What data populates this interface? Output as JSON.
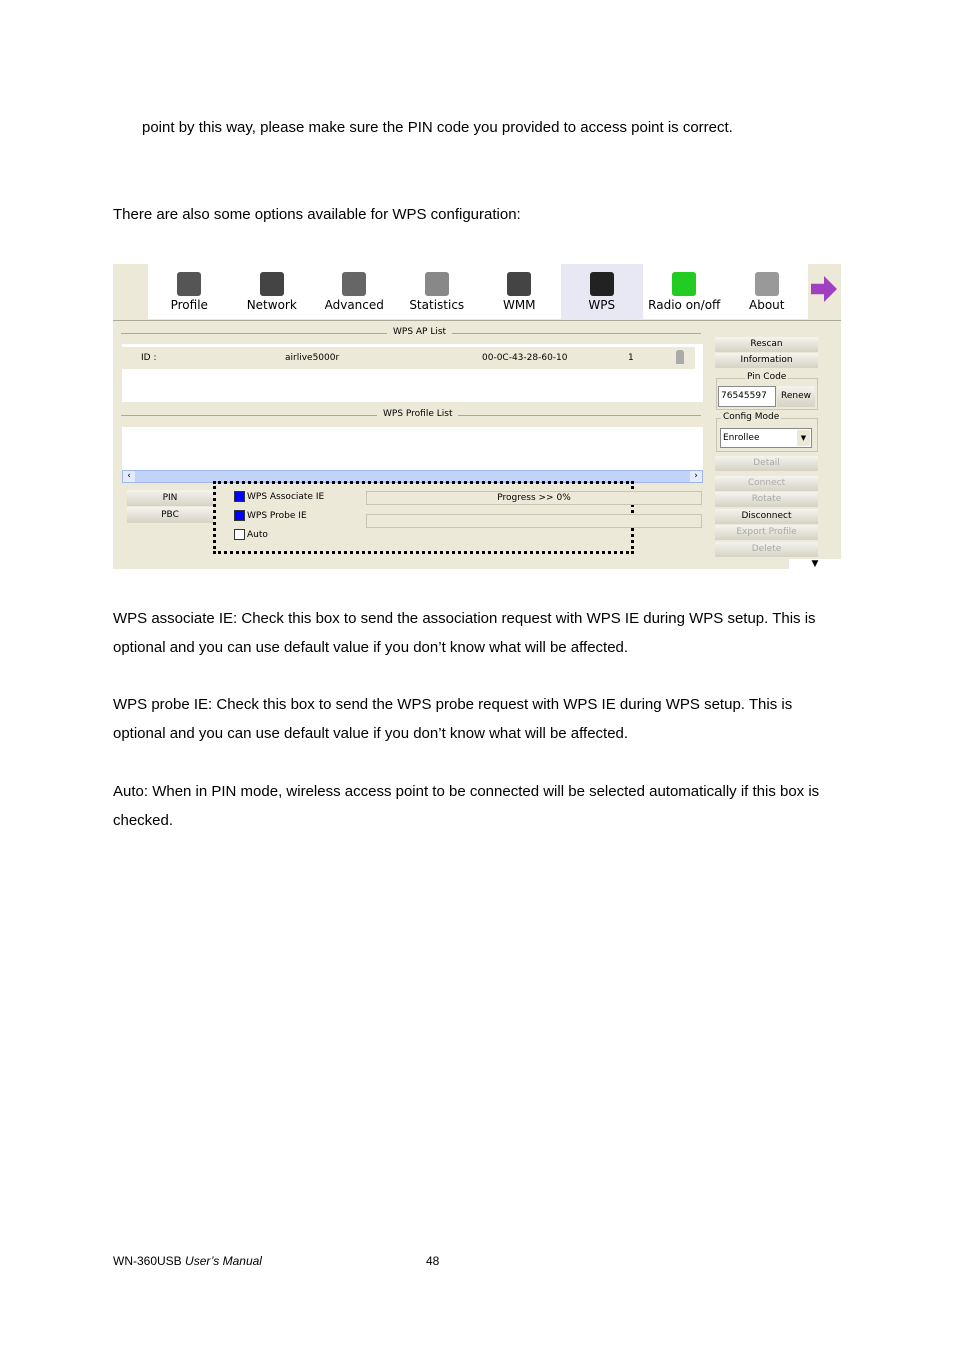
{
  "paragraphs": [
    "point by this way, please make sure the PIN code you provided to access point is correct.",
    "There are also some options available for WPS configuration:",
    "WPS associate IE: Check this box to send the association request with WPS IE during WPS setup. This is optional and you can use default value if you don’t know what will be affected.",
    "WPS probe IE: Check this box to send the WPS probe request with WPS IE during WPS setup. This is optional and you can use default value if you don’t know what will be affected.",
    "Auto: When in PIN mode, wireless access point to be connected will be selected automatically if this box is checked."
  ],
  "toolbar": [
    {
      "label": "Profile",
      "icon": "profile-icon",
      "color": "#555555"
    },
    {
      "label": "Network",
      "icon": "router-icon",
      "color": "#444444"
    },
    {
      "label": "Advanced",
      "icon": "gears-icon",
      "color": "#666666"
    },
    {
      "label": "Statistics",
      "icon": "calculator-icon",
      "color": "#888888"
    },
    {
      "label": "WMM",
      "icon": "qos-icon",
      "color": "#444444"
    },
    {
      "label": "WPS",
      "icon": "wps-icon",
      "color": "#222222"
    },
    {
      "label": "Radio on/off",
      "icon": "antenna-icon",
      "color": "#22cc22"
    },
    {
      "label": "About",
      "icon": "about-icon",
      "color": "#999999"
    }
  ],
  "ap_list": {
    "title": "WPS AP List",
    "row": {
      "id": "ID :",
      "ssid": "airlive5000r",
      "bssid": "00-0C-43-28-60-10",
      "channel": "1"
    }
  },
  "profile_list": {
    "title": "WPS Profile List"
  },
  "left_buttons": {
    "pin": "PIN",
    "pbc": "PBC"
  },
  "options": [
    {
      "label": "WPS Associate IE",
      "checked": true
    },
    {
      "label": "WPS Probe IE",
      "checked": true
    },
    {
      "label": "Auto",
      "checked": false
    }
  ],
  "progress": {
    "text": "Progress >> 0%",
    "value": 0
  },
  "right": {
    "rescan": "Rescan",
    "information": "Information",
    "pin_code_label": "Pin Code",
    "pin_code": "76545597",
    "renew": "Renew",
    "config_mode_label": "Config Mode",
    "config_mode": "Enrollee",
    "detail": "Detail",
    "connect": "Connect",
    "rotate": "Rotate",
    "disconnect": "Disconnect",
    "export_profile": "Export Profile",
    "delete": "Delete"
  },
  "footer": {
    "manual": "WN-360USB",
    "manual_italic": "User’s Manual",
    "page": "48"
  }
}
